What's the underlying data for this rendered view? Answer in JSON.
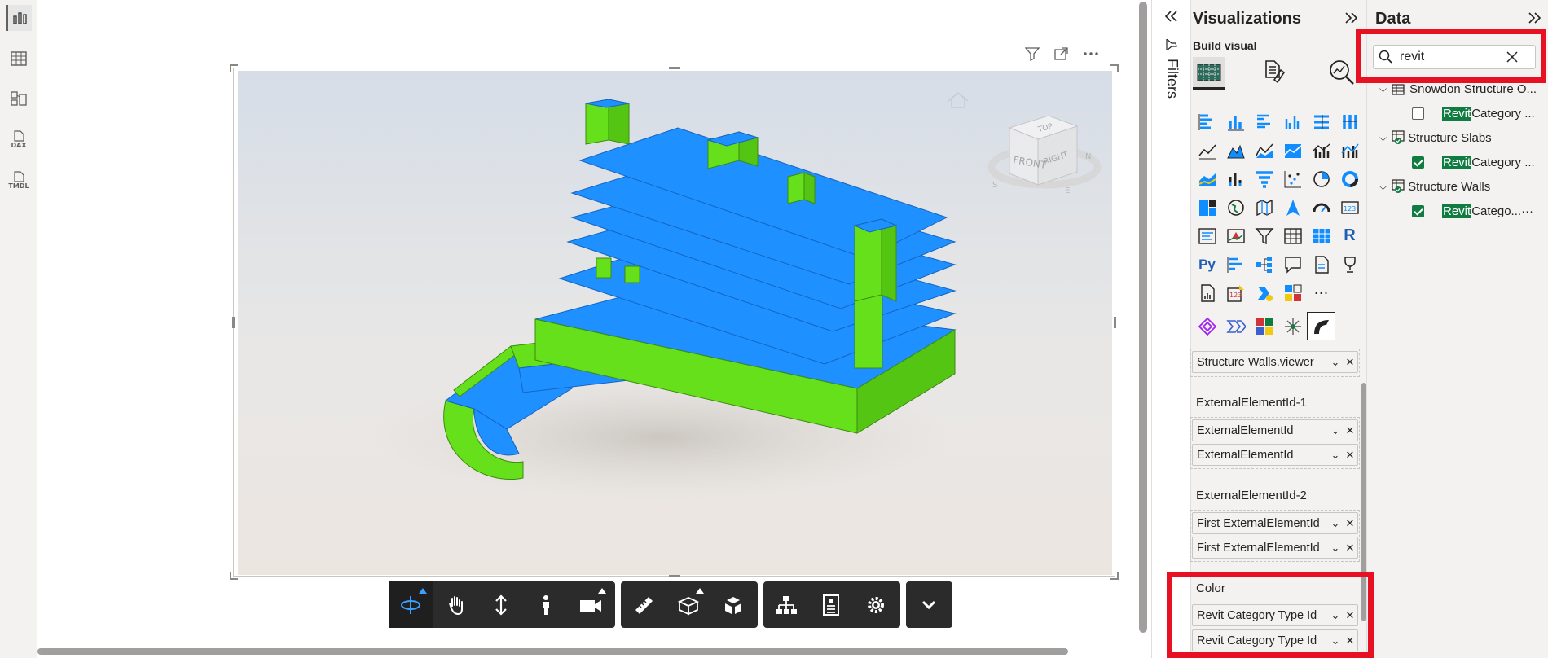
{
  "left_rail": {
    "items": [
      {
        "name": "report-view-icon",
        "text": ""
      },
      {
        "name": "table-view-icon",
        "text": ""
      },
      {
        "name": "model-view-icon",
        "text": ""
      },
      {
        "name": "dax-query-view-icon",
        "text": "DAX"
      },
      {
        "name": "tmdl-view-icon",
        "text": "TMDL"
      }
    ]
  },
  "visual": {
    "header_icons": [
      "filter-icon",
      "focus-mode-icon",
      "more-options-icon"
    ],
    "model_colors": {
      "slab": "#1e90ff",
      "wall": "#66e01a"
    },
    "viewcube": {
      "top": "TOP",
      "front": "FRONT",
      "right": "RIGHT",
      "n": "N",
      "s": "S",
      "e": "E"
    },
    "toolbar": {
      "groups": [
        [
          "orbit-icon",
          "pan-icon",
          "dolly-icon",
          "first-person-icon",
          "camera-icon"
        ],
        [
          "measure-icon",
          "section-icon",
          "explode-icon"
        ],
        [
          "model-browser-icon",
          "properties-icon",
          "settings-icon"
        ],
        [
          "collapse-chevron-icon"
        ]
      ]
    }
  },
  "filters": {
    "label": "Filters"
  },
  "visualizations": {
    "title": "Visualizations",
    "build_visual": "Build visual",
    "wells": {
      "top_pill": "Structure Walls.viewer",
      "ext1_label": "ExternalElementId-1",
      "ext1_pills": [
        "ExternalElementId",
        "ExternalElementId"
      ],
      "ext2_label": "ExternalElementId-2",
      "ext2_pills": [
        "First ExternalElementId",
        "First ExternalElementId"
      ],
      "color_label": "Color",
      "color_pills": [
        "Revit Category Type Id",
        "Revit Category Type Id"
      ]
    },
    "more_label": "···",
    "r_label": "R",
    "py_label": "Py",
    "num_label": "123"
  },
  "data": {
    "title": "Data",
    "search_value": "revit",
    "tree": [
      {
        "table": "Snowdon Structure O...",
        "field_hl": "Revit",
        "field_rest": " Category ...",
        "checked": false
      },
      {
        "table": "Structure Slabs",
        "field_hl": "Revit",
        "field_rest": " Category ...",
        "checked": true
      },
      {
        "table": "Structure Walls",
        "field_hl": "Revit",
        "field_rest": " Catego... ",
        "checked": true
      }
    ],
    "more": "···"
  },
  "highlight_color": "#e81123"
}
